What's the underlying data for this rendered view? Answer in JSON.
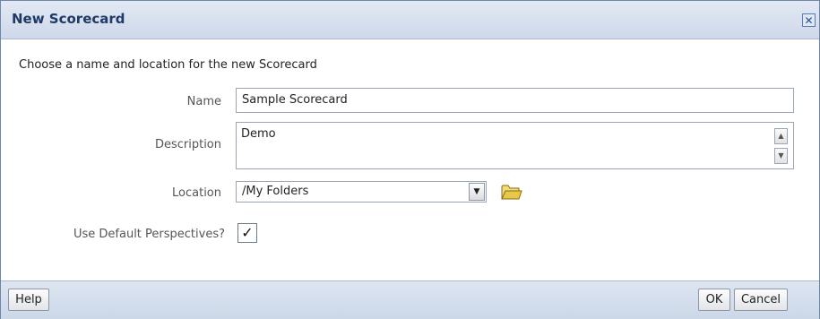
{
  "dialog": {
    "title": "New Scorecard",
    "close_glyph": "✕"
  },
  "form": {
    "instruction": "Choose a name and location for the new Scorecard",
    "name_label": "Name",
    "name_value": "Sample Scorecard",
    "description_label": "Description",
    "description_value": "Demo",
    "location_label": "Location",
    "location_value": "/My Folders",
    "default_perspectives_label": "Use Default Perspectives?",
    "default_perspectives_checked": true
  },
  "footer": {
    "help_label": "Help",
    "ok_label": "OK",
    "cancel_label": "Cancel"
  },
  "icons": {
    "close": "close-icon",
    "folder": "folder-icon",
    "dropdown": "chevron-down-icon"
  },
  "colors": {
    "title_text": "#1f3a66",
    "titlebar_bg": "#d5dfee",
    "folder_yellow": "#e8c84a"
  }
}
